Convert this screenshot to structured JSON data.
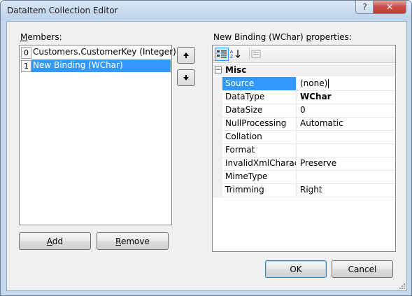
{
  "window": {
    "title": "DataItem Collection Editor"
  },
  "titlebar": {
    "help_glyph": "?",
    "close_glyph": "✕"
  },
  "members": {
    "label_prefix": "",
    "label_access": "M",
    "label_rest": "embers:",
    "items": [
      {
        "index": "0",
        "text": "Customers.CustomerKey (Integer)",
        "selected": false
      },
      {
        "index": "1",
        "text": "New Binding (WChar)",
        "selected": true
      }
    ]
  },
  "move_up_icon": "up-arrow",
  "move_down_icon": "down-arrow",
  "buttons": {
    "add_access": "A",
    "add_rest": "dd",
    "remove_access": "R",
    "remove_rest": "emove",
    "ok": "OK",
    "cancel": "Cancel"
  },
  "properties": {
    "label_before": "New Binding (WChar) ",
    "label_access": "p",
    "label_after": "roperties:",
    "toolbar": [
      "categorized-icon",
      "alphabetical-icon",
      "property-pages-icon"
    ],
    "category": {
      "toggle": "−",
      "name": "Misc"
    },
    "rows": [
      {
        "name": "Source",
        "value": "(none)",
        "selected": true,
        "bold": false
      },
      {
        "name": "DataType",
        "value": "WChar",
        "selected": false,
        "bold": true
      },
      {
        "name": "DataSize",
        "value": "0",
        "selected": false,
        "bold": false
      },
      {
        "name": "NullProcessing",
        "value": "Automatic",
        "selected": false,
        "bold": false
      },
      {
        "name": "Collation",
        "value": "",
        "selected": false,
        "bold": false
      },
      {
        "name": "Format",
        "value": "",
        "selected": false,
        "bold": false
      },
      {
        "name": "InvalidXmlCharacte",
        "value": "Preserve",
        "selected": false,
        "bold": false
      },
      {
        "name": "MimeType",
        "value": "",
        "selected": false,
        "bold": false
      },
      {
        "name": "Trimming",
        "value": "Right",
        "selected": false,
        "bold": false
      }
    ]
  }
}
